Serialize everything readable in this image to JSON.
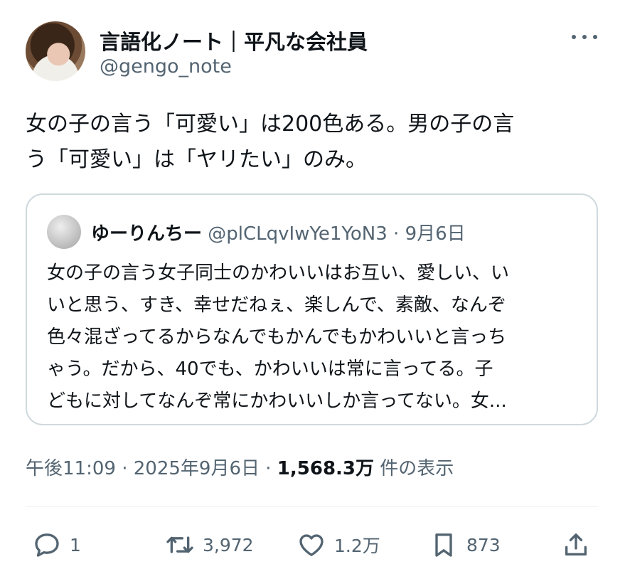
{
  "author": {
    "name": "言語化ノート｜平凡な会社員",
    "handle": "@gengo_note"
  },
  "tweet": {
    "lines": [
      "女の子の言う「可愛い」は200色ある。男の子の言",
      "う「可愛い」は「ヤリたい」のみ。"
    ]
  },
  "quote": {
    "name": "ゆーりんちー",
    "handle": "@plCLqvIwYe1YoN3",
    "separator": "·",
    "date": "9月6日",
    "lines": [
      "女の子の言う女子同士のかわいいはお互い、愛しい、い",
      "いと思う、すき、幸せだねぇ、楽しんで、素敵、なんぞ",
      "色々混ざってるからなんでもかんでもかわいいと言っち",
      "ゃう。だから、40でも、かわいいは常に言ってる。子",
      "どもに対してなんぞ常にかわいいしか言ってない。女..."
    ]
  },
  "meta": {
    "time": "午後11:09",
    "separator": "·",
    "date": "2025年9月6日",
    "views_count": "1,568.3万",
    "views_label": "件の表示"
  },
  "actions": {
    "replies": "1",
    "reposts": "3,972",
    "likes": "1.2万",
    "bookmarks": "873"
  },
  "colors": {
    "text": "#0f1419",
    "secondary": "#536471",
    "border": "#cfd9de",
    "divider": "#eff3f4"
  },
  "icons": [
    "more-icon",
    "reply-icon",
    "repost-icon",
    "like-icon",
    "bookmark-icon",
    "share-icon"
  ]
}
